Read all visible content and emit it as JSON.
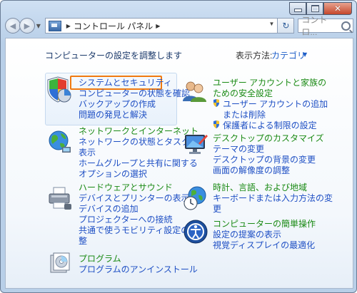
{
  "window": {
    "title": "コントロール パネル"
  },
  "nav": {
    "breadcrumb": "コントロール パネル",
    "search_placeholder": "コントロ..."
  },
  "header": {
    "heading": "コンピューターの設定を調整します",
    "view_by_label": "表示方法:",
    "view_by_value": "カテゴリ"
  },
  "categories": {
    "system": {
      "title": "システムとセキュリティ",
      "links": [
        "コンピューターの状態を確認",
        "バックアップの作成",
        "問題の発見と解決"
      ],
      "icon": "shield-pie-icon"
    },
    "network": {
      "title": "ネットワークとインターネット",
      "links": [
        "ネットワークの状態とタスクの",
        "表示",
        "ホームグループと共有に関する",
        "オプションの選択"
      ],
      "icon": "globe-network-icon"
    },
    "hardware": {
      "title": "ハードウェアとサウンド",
      "links": [
        "デバイスとプリンターの表示",
        "デバイスの追加",
        "プロジェクターへの接続",
        "共通で使うモビリティ設定の調",
        "整"
      ],
      "icon": "printer-icon"
    },
    "programs": {
      "title": "プログラム",
      "links": [
        "プログラムのアンインストール"
      ],
      "icon": "programs-icon"
    },
    "users": {
      "title_lines": [
        "ユーザー アカウントと家族の",
        "ための安全設定"
      ],
      "links": [
        "ユーザー アカウントの追加",
        "または削除",
        "保護者による制限の設定"
      ],
      "icon": "users-icon"
    },
    "appearance": {
      "title": "デスクトップのカスタマイズ",
      "links": [
        "テーマの変更",
        "デスクトップの背景の変更",
        "画面の解像度の調整"
      ],
      "icon": "desktop-icon"
    },
    "clock": {
      "title": "時計、言語、および地域",
      "links": [
        "キーボードまたは入力方法の変",
        "更"
      ],
      "icon": "clock-globe-icon"
    },
    "ease": {
      "title": "コンピューターの簡単操作",
      "links": [
        "設定の提案の表示",
        "視覚ディスプレイの最適化"
      ],
      "icon": "ease-of-access-icon"
    }
  },
  "colors": {
    "title_green": "#1a8a14",
    "link_blue": "#1e4fc4",
    "highlight_orange": "#f07a10"
  }
}
